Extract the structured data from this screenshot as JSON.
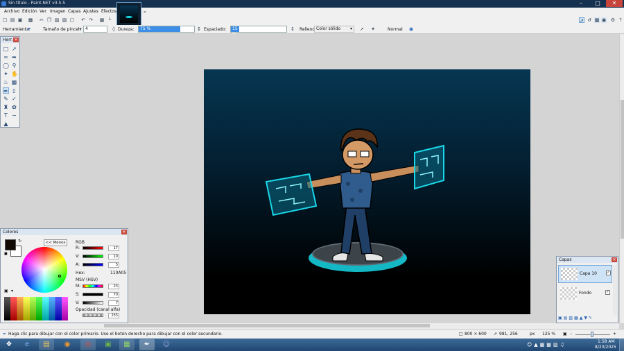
{
  "window": {
    "title": "Sin título - Paint.NET v3.5.5"
  },
  "menu": [
    "Archivo",
    "Edición",
    "Ver",
    "Imagen",
    "Capas",
    "Ajustes",
    "Efectos"
  ],
  "toolbar": {
    "tool_label": "Herramienta:",
    "brush_size_label": "Tamaño de pincel:",
    "brush_size_value": "4",
    "hardness_label": "Dureza:",
    "hardness_value": "75 %",
    "hardness_fraction": 0.75,
    "spacing_label": "Espaciado:",
    "spacing_value": "15 %",
    "spacing_fraction": 0.15,
    "fill_label": "Relleno:",
    "fill_value": "Color sólido",
    "blend_value": "Normal"
  },
  "tools_palette": {
    "title": "Herr..."
  },
  "colors_palette": {
    "title": "Colores",
    "less_button": "<< Menos",
    "rgb_label": "RGB",
    "r_label": "R:",
    "r_value": "17",
    "g_label": "V:",
    "g_value": "10",
    "b_label": "A:",
    "b_value": "5",
    "hex_label": "Hex:",
    "hex_value": "110A05",
    "hsv_label": "MSV (HSV)",
    "h_label": "M:",
    "h_value": "23",
    "s_label": "S:",
    "s_value": "70",
    "v_label": "V:",
    "v_value": "7",
    "alpha_label": "Opacidad (canal alfa)",
    "alpha_value": "255",
    "primary_color": "#110A05",
    "secondary_color": "#FFFFFF"
  },
  "layers_palette": {
    "title": "Capas",
    "layers": [
      {
        "name": "Capa 10",
        "visible": true
      },
      {
        "name": "Fondo",
        "visible": true
      }
    ]
  },
  "status": {
    "hint": "Haga clic para dibujar con el color primario. Use el botón derecho para dibujar con el color secundario.",
    "image_size": "800 × 600",
    "cursor_pos": "981, 256",
    "unit": "px",
    "zoom": "125 %"
  },
  "taskbar": {
    "time": "1:58 AM",
    "date": "8/23/2025",
    "apps": [
      "start-orb",
      "ie-icon",
      "explorer-icon",
      "blender-icon",
      "chrome-icon",
      "minecraft-icon",
      "paintnet-icon",
      "discord-icon"
    ]
  },
  "colors": {
    "accent": "#3C8EE6",
    "glow": "#18D8E8",
    "titlebar": "#16314F"
  }
}
